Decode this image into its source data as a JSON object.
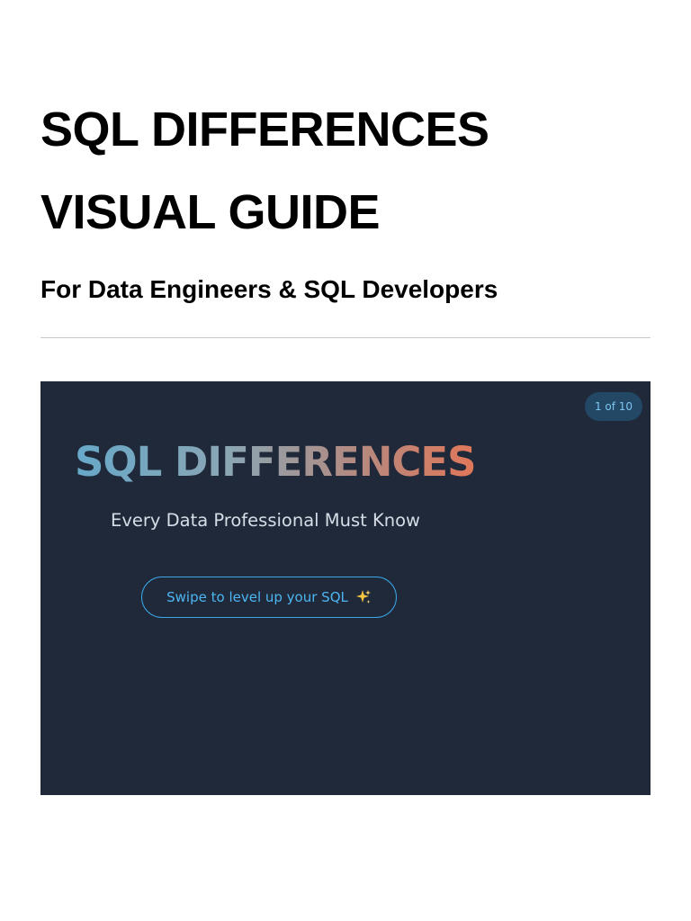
{
  "document": {
    "title": "SQL DIFFERENCES VISUAL GUIDE",
    "subtitle": "For Data Engineers & SQL Developers"
  },
  "slide": {
    "counter": "1 of 10",
    "title": "SQL DIFFERENCES",
    "subtitle": "Every Data Professional Must Know",
    "cta_label": "Swipe to level up your SQL",
    "cta_icon": "sparkles-icon",
    "colors": {
      "background": "#1f293a",
      "accent": "#3aa7e6",
      "title_gradient": [
        "#67a8c9",
        "#8aa6b4",
        "#b48a80",
        "#e0775a"
      ]
    }
  }
}
